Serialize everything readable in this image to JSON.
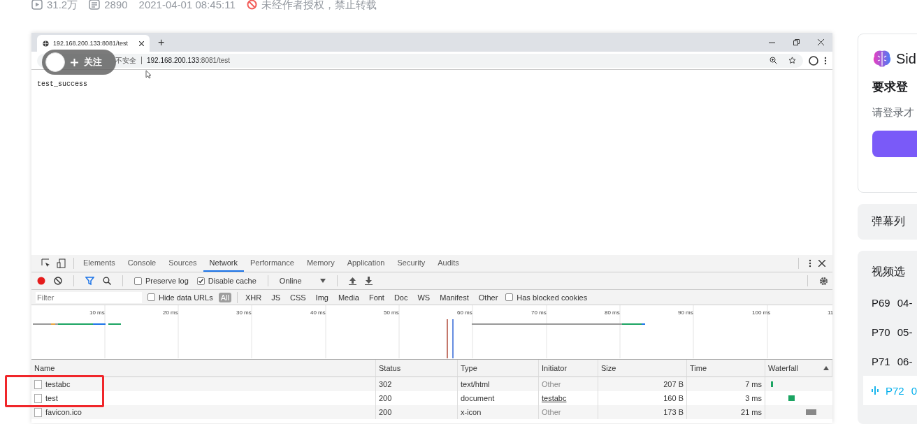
{
  "video_meta": {
    "plays": "31.2万",
    "comments": "2890",
    "date": "2021-04-01 08:45:11",
    "notice": "未经作者授权，禁止转载"
  },
  "browser": {
    "tab_title": "192.168.200.133:8081/test",
    "new_tab": "+",
    "security": "不安全",
    "url_host": "192.168.200.133",
    "url_rest": ":8081/test",
    "content": "test_success"
  },
  "follow_overlay": {
    "label": "关注"
  },
  "devtools": {
    "tabs": [
      {
        "label": "Elements",
        "selected": false
      },
      {
        "label": "Console",
        "selected": false
      },
      {
        "label": "Sources",
        "selected": false
      },
      {
        "label": "Network",
        "selected": true
      },
      {
        "label": "Performance",
        "selected": false
      },
      {
        "label": "Memory",
        "selected": false
      },
      {
        "label": "Application",
        "selected": false
      },
      {
        "label": "Security",
        "selected": false
      },
      {
        "label": "Audits",
        "selected": false
      }
    ],
    "toolbar": {
      "preserve_log": {
        "label": "Preserve log",
        "checked": false
      },
      "disable_cache": {
        "label": "Disable cache",
        "checked": true
      },
      "throttle": "Online"
    },
    "filter": {
      "placeholder": "Filter",
      "hide_data_urls": {
        "label": "Hide data URLs",
        "checked": false
      },
      "types": [
        {
          "label": "All",
          "selected": true
        },
        {
          "label": "XHR",
          "selected": false
        },
        {
          "label": "JS",
          "selected": false
        },
        {
          "label": "CSS",
          "selected": false
        },
        {
          "label": "Img",
          "selected": false
        },
        {
          "label": "Media",
          "selected": false
        },
        {
          "label": "Font",
          "selected": false
        },
        {
          "label": "Doc",
          "selected": false
        },
        {
          "label": "WS",
          "selected": false
        },
        {
          "label": "Manifest",
          "selected": false
        },
        {
          "label": "Other",
          "selected": false
        }
      ],
      "has_blocked_cookies": {
        "label": "Has blocked cookies",
        "checked": false
      }
    },
    "timeline_ticks": [
      "10 ms",
      "20 ms",
      "30 ms",
      "40 ms",
      "50 ms",
      "60 ms",
      "70 ms",
      "80 ms",
      "90 ms",
      "100 ms",
      "11"
    ],
    "table": {
      "columns": [
        "Name",
        "Status",
        "Type",
        "Initiator",
        "Size",
        "Time",
        "Waterfall"
      ],
      "rows": [
        {
          "name": "testabc",
          "status": "302",
          "type": "text/html",
          "initiator": "Other",
          "initiator_linked": false,
          "size": "207 B",
          "time": "7 ms"
        },
        {
          "name": "test",
          "status": "200",
          "type": "document",
          "initiator": "testabc",
          "initiator_linked": true,
          "size": "160 B",
          "time": "3 ms"
        },
        {
          "name": "favicon.ico",
          "status": "200",
          "type": "x-icon",
          "initiator": "Other",
          "initiator_linked": false,
          "size": "173 B",
          "time": "21 ms"
        }
      ]
    }
  },
  "sidebar": {
    "ai_card": {
      "title": "Sid",
      "heading": "要求登",
      "text": "请登录才"
    },
    "danmaku": {
      "title": "弹幕列"
    },
    "episodes": {
      "title": "视频选",
      "items": [
        {
          "label": "P69",
          "date": "04-",
          "selected": false
        },
        {
          "label": "P70",
          "date": "05-",
          "selected": false
        },
        {
          "label": "P71",
          "date": "06-",
          "selected": false
        },
        {
          "label": "P72",
          "date": "0",
          "selected": true
        }
      ]
    }
  }
}
